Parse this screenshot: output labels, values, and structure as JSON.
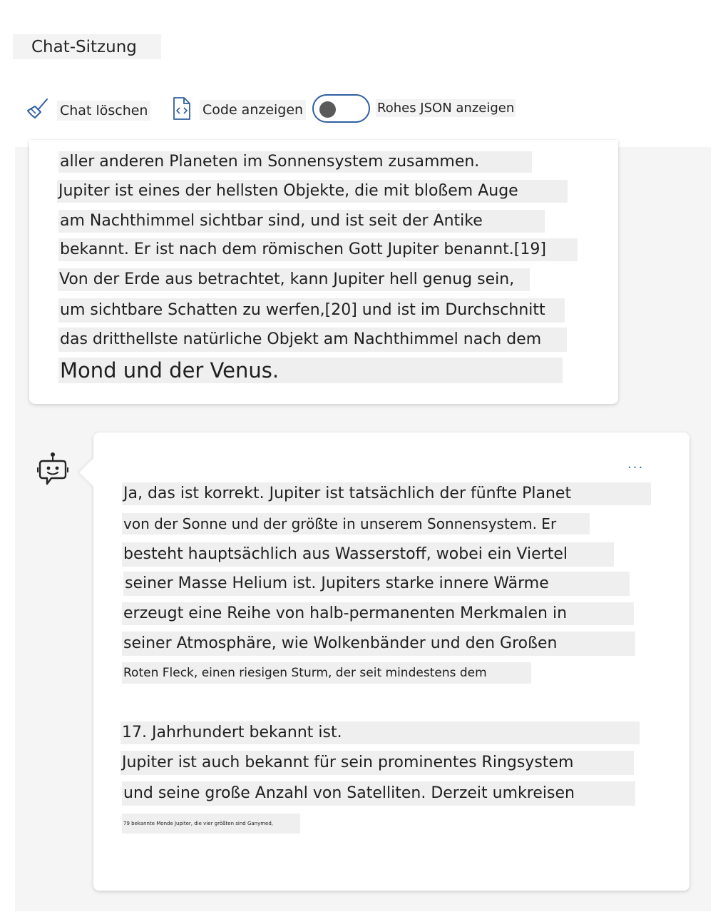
{
  "header": {
    "title": "Chat-Sitzung"
  },
  "toolbar": {
    "clear_label": "Chat löschen",
    "code_label": "Code anzeigen",
    "json_toggle_label": "Rohes JSON anzeigen",
    "json_toggle_on": false
  },
  "icons": {
    "clear": "broom-icon",
    "code": "code-file-icon",
    "bot": "bot-avatar-icon",
    "more": "more-options-icon"
  },
  "colors": {
    "accent": "#2f5fa0",
    "link": "#2f6fd0",
    "highlight": "#efefef",
    "panel": "#f5f5f5"
  },
  "messages": [
    {
      "role": "user",
      "lines": [
        "aller anderen Planeten im Sonnensystem zusammen.",
        "Jupiter ist eines der hellsten Objekte, die mit bloßem Auge",
        "am Nachthimmel sichtbar sind, und ist seit der Antike",
        "bekannt. Er ist nach dem römischen Gott Jupiter benannt.[19]",
        "Von der Erde aus betrachtet, kann Jupiter hell genug sein,",
        "um sichtbare Schatten zu werfen,[20] und ist im Durchschnitt",
        "das dritthellste natürliche Objekt am Nachthimmel nach dem",
        "Mond und der Venus."
      ]
    },
    {
      "role": "assistant",
      "more_label": "...",
      "lines": [
        "Ja, das ist korrekt. Jupiter ist tatsächlich der fünfte Planet",
        "von der Sonne und der größte in unserem Sonnensystem. Er",
        "besteht hauptsächlich aus Wasserstoff, wobei ein Viertel",
        "seiner Masse Helium ist. Jupiters starke innere Wärme",
        "erzeugt eine Reihe von halb-permanenten Merkmalen in",
        "seiner Atmosphäre, wie Wolkenbänder und den Großen",
        "Roten Fleck, einen riesigen Sturm, der seit mindestens dem",
        "17. Jahrhundert bekannt ist.",
        "Jupiter ist auch bekannt für sein prominentes Ringsystem",
        "und seine große Anzahl von Satelliten. Derzeit umkreisen",
        "79 bekannte Monde Jupiter, die vier größten sind Ganymed,"
      ]
    }
  ]
}
